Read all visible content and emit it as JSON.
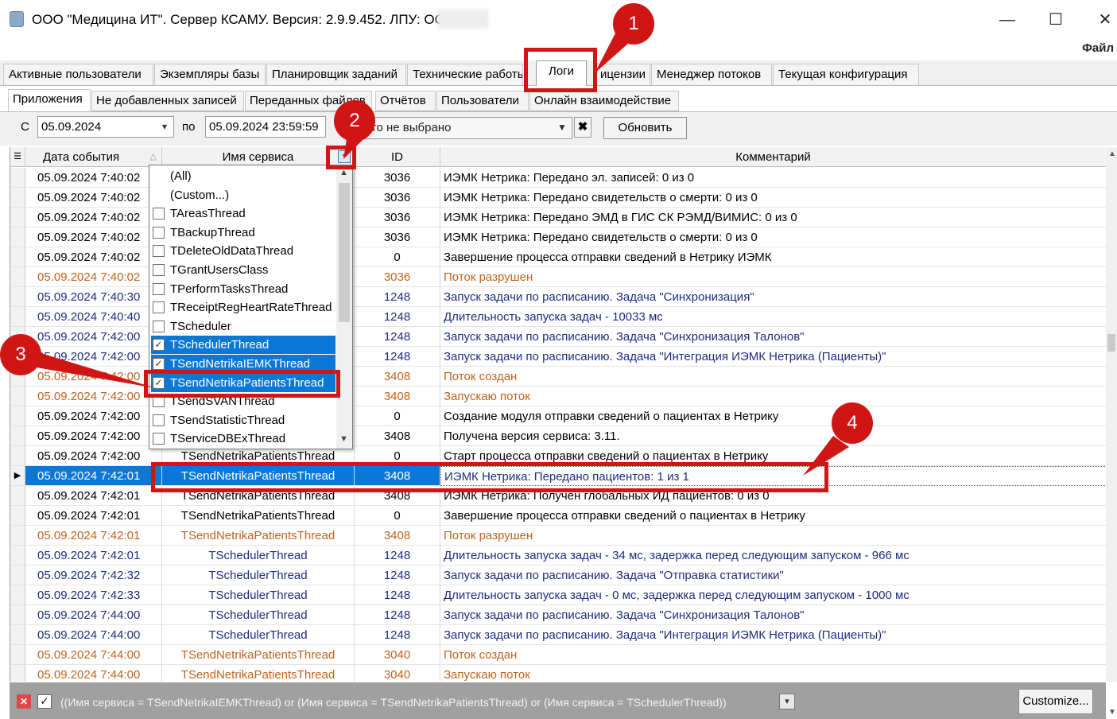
{
  "window": {
    "title": "ООО \"Медицина ИТ\". Сервер КСАМУ. Версия: 2.9.9.452. ЛПУ: ООО",
    "minimize": "—",
    "maximize": "☐",
    "close": "✕",
    "menu_file": "Файл"
  },
  "main_tabs": [
    {
      "label": "Активные пользователи"
    },
    {
      "label": "Экземпляры базы"
    },
    {
      "label": "Планировщик заданий"
    },
    {
      "label": "Технические работы"
    },
    {
      "label": "Логи"
    },
    {
      "label": "ицензии"
    },
    {
      "label": "Менеджер потоков"
    },
    {
      "label": "Текущая конфигурация"
    }
  ],
  "sub_tabs": [
    {
      "label": "Приложения"
    },
    {
      "label": "Не добавленных записей"
    },
    {
      "label": "Переданных файлов"
    },
    {
      "label": "Отчётов"
    },
    {
      "label": "Пользователи"
    },
    {
      "label": "Онлайн взаимодействие"
    }
  ],
  "filter": {
    "from_label": "С",
    "from_value": "05.09.2024",
    "to_label": "по",
    "to_value": "05.09.2024 23:59:59",
    "selection_text": "его не выбрано",
    "clear_glyph": "✖",
    "refresh_label": "Обновить"
  },
  "grid": {
    "columns": {
      "date": "Дата события",
      "service": "Имя сервиса",
      "id": "ID",
      "comment": "Комментарий"
    },
    "rows": [
      {
        "date": "05.09.2024 7:40:02",
        "service": "",
        "id": "3036",
        "comment": "ИЭМК Нетрика: Передано эл. записей: 0 из 0",
        "kind": "normal"
      },
      {
        "date": "05.09.2024 7:40:02",
        "service": "",
        "id": "3036",
        "comment": "ИЭМК Нетрика: Передано свидетельств о смерти: 0 из 0",
        "kind": "normal"
      },
      {
        "date": "05.09.2024 7:40:02",
        "service": "",
        "id": "3036",
        "comment": "ИЭМК Нетрика: Передано ЭМД в ГИС СК РЭМД/ВИМИС: 0 из 0",
        "kind": "normal"
      },
      {
        "date": "05.09.2024 7:40:02",
        "service": "",
        "id": "3036",
        "comment": "ИЭМК Нетрика: Передано свидетельств о смерти: 0 из 0",
        "kind": "normal"
      },
      {
        "date": "05.09.2024 7:40:02",
        "service": "",
        "id": "0",
        "comment": "Завершение процесса отправки сведений в Нетрику ИЭМК",
        "kind": "normal"
      },
      {
        "date": "05.09.2024 7:40:02",
        "service": "",
        "id": "3036",
        "comment": "Поток разрушен",
        "kind": "orange"
      },
      {
        "date": "05.09.2024 7:40:30",
        "service": "",
        "id": "1248",
        "comment": "Запуск задачи по расписанию. Задача \"Синхронизация\"",
        "kind": "blue"
      },
      {
        "date": "05.09.2024 7:40:40",
        "service": "",
        "id": "1248",
        "comment": "Длительность запуска задач - 10033 мс",
        "kind": "blue"
      },
      {
        "date": "05.09.2024 7:42:00",
        "service": "",
        "id": "1248",
        "comment": "Запуск задачи по расписанию. Задача \"Синхронизация Талонов\"",
        "kind": "blue"
      },
      {
        "date": "05.09.2024 7:42:00",
        "service": "",
        "id": "1248",
        "comment": "Запуск задачи по расписанию. Задача \"Интеграция ИЭМК Нетрика (Пациенты)\"",
        "kind": "blue"
      },
      {
        "date": "05.09.2024 7:42:00",
        "service": "",
        "id": "3408",
        "comment": "Поток создан",
        "kind": "orange"
      },
      {
        "date": "05.09.2024 7:42:00",
        "service": "",
        "id": "3408",
        "comment": "Запускаю поток",
        "kind": "orange"
      },
      {
        "date": "05.09.2024 7:42:00",
        "service": "",
        "id": "0",
        "comment": "Создание модуля отправки сведений о пациентах в Нетрику",
        "kind": "normal"
      },
      {
        "date": "05.09.2024 7:42:00",
        "service": "",
        "id": "3408",
        "comment": "Получена версия сервиса: 3.11.",
        "kind": "normal"
      },
      {
        "date": "05.09.2024 7:42:00",
        "service": "TSendNetrikaPatientsThread",
        "id": "0",
        "comment": "Старт процесса отправки сведений о пациентах в Нетрику",
        "kind": "normal"
      },
      {
        "date": "05.09.2024 7:42:01",
        "service": "TSendNetrikaPatientsThread",
        "id": "3408",
        "comment": "ИЭМК Нетрика: Передано пациентов: 1 из 1",
        "kind": "sel"
      },
      {
        "date": "05.09.2024 7:42:01",
        "service": "TSendNetrikaPatientsThread",
        "id": "3408",
        "comment": "ИЭМК Нетрика: Получен глобальных ИД пациентов: 0 из 0",
        "kind": "normal"
      },
      {
        "date": "05.09.2024 7:42:01",
        "service": "TSendNetrikaPatientsThread",
        "id": "0",
        "comment": "Завершение процесса отправки сведений о пациентах в Нетрику",
        "kind": "normal"
      },
      {
        "date": "05.09.2024 7:42:01",
        "service": "TSendNetrikaPatientsThread",
        "id": "3408",
        "comment": "Поток разрушен",
        "kind": "orange"
      },
      {
        "date": "05.09.2024 7:42:01",
        "service": "TSchedulerThread",
        "id": "1248",
        "comment": "Длительность запуска задач - 34 мс, задержка перед следующим запуском - 966 мс",
        "kind": "blue"
      },
      {
        "date": "05.09.2024 7:42:32",
        "service": "TSchedulerThread",
        "id": "1248",
        "comment": "Запуск задачи по расписанию. Задача \"Отправка статистики\"",
        "kind": "blue"
      },
      {
        "date": "05.09.2024 7:42:33",
        "service": "TSchedulerThread",
        "id": "1248",
        "comment": "Длительность запуска задач - 0 мс, задержка перед следующим запуском - 1000 мс",
        "kind": "blue"
      },
      {
        "date": "05.09.2024 7:44:00",
        "service": "TSchedulerThread",
        "id": "1248",
        "comment": "Запуск задачи по расписанию. Задача \"Синхронизация Талонов\"",
        "kind": "blue"
      },
      {
        "date": "05.09.2024 7:44:00",
        "service": "TSchedulerThread",
        "id": "1248",
        "comment": "Запуск задачи по расписанию. Задача \"Интеграция ИЭМК Нетрика (Пациенты)\"",
        "kind": "blue"
      },
      {
        "date": "05.09.2024 7:44:00",
        "service": "TSendNetrikaPatientsThread",
        "id": "3040",
        "comment": "Поток создан",
        "kind": "orange"
      },
      {
        "date": "05.09.2024 7:44:00",
        "service": "TSendNetrikaPatientsThread",
        "id": "3040",
        "comment": "Запускаю поток",
        "kind": "orange"
      }
    ]
  },
  "service_dropdown": {
    "items": [
      {
        "label": "(All)",
        "checkbox": false,
        "checked": false
      },
      {
        "label": "(Custom...)",
        "checkbox": false,
        "checked": false
      },
      {
        "label": "TAreasThread",
        "checkbox": true,
        "checked": false
      },
      {
        "label": "TBackupThread",
        "checkbox": true,
        "checked": false
      },
      {
        "label": "TDeleteOldDataThread",
        "checkbox": true,
        "checked": false
      },
      {
        "label": "TGrantUsersClass",
        "checkbox": true,
        "checked": false
      },
      {
        "label": "TPerformTasksThread",
        "checkbox": true,
        "checked": false
      },
      {
        "label": "TReceiptRegHeartRateThread",
        "checkbox": true,
        "checked": false
      },
      {
        "label": "TScheduler",
        "checkbox": true,
        "checked": false
      },
      {
        "label": "TSchedulerThread",
        "checkbox": true,
        "checked": true
      },
      {
        "label": "TSendNetrikaIEMKThread",
        "checkbox": true,
        "checked": true
      },
      {
        "label": "TSendNetrikaPatientsThread",
        "checkbox": true,
        "checked": true
      },
      {
        "label": "TSendSVANThread",
        "checkbox": true,
        "checked": false
      },
      {
        "label": "TSendStatisticThread",
        "checkbox": true,
        "checked": false
      },
      {
        "label": "TServiceDBExThread",
        "checkbox": true,
        "checked": false
      }
    ]
  },
  "status_bar": {
    "filter_text": "((Имя сервиса = TSendNetrikaIEMKThread) or (Имя сервиса = TSendNetrikaPatientsThread) or (Имя сервиса = TSchedulerThread))",
    "customize_label": "Customize..."
  },
  "callouts": [
    "1",
    "2",
    "3",
    "4"
  ],
  "colors": {
    "selection": "#0b78d7",
    "orange_row": "#c0621e",
    "blue_row": "#1e2c7e",
    "callout": "#d01515"
  }
}
